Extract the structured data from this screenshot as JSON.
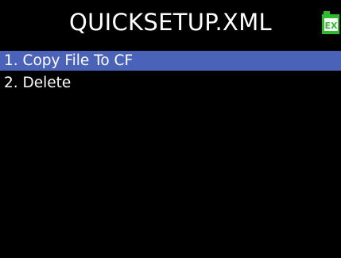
{
  "header": {
    "title": "QUICKSETUP.XML",
    "file_icon": {
      "name": "excel-file-icon",
      "text": "EX",
      "color": "#2dbb2d"
    }
  },
  "menu": {
    "items": [
      {
        "label": "1. Copy File To CF",
        "selected": true
      },
      {
        "label": "2. Delete",
        "selected": false
      }
    ]
  },
  "colors": {
    "background": "#000000",
    "selection": "#4a63b8",
    "text": "#ffffff"
  }
}
